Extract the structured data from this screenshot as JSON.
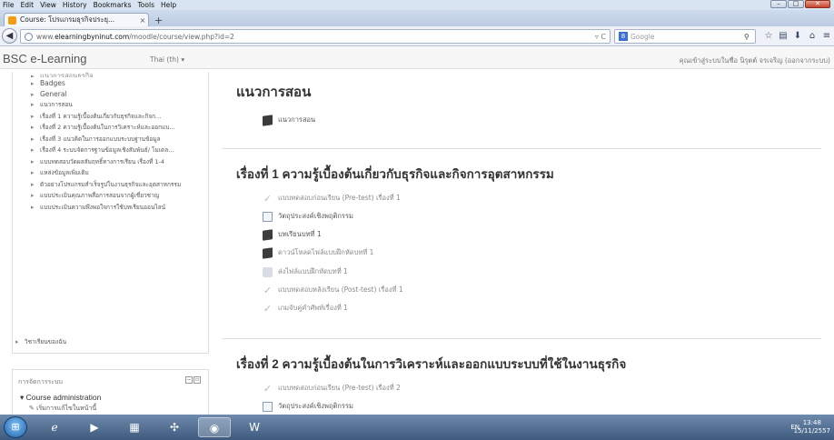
{
  "browser": {
    "menu": [
      "File",
      "Edit",
      "View",
      "History",
      "Bookmarks",
      "Tools",
      "Help"
    ],
    "tab_title": "Course: โปรแกรมธุรกิจประยุ...",
    "url_prefix": "www.",
    "url_domain": "elearningbyninut.com",
    "url_path": "/moodle/course/view.php?id=2",
    "search_placeholder": "Google",
    "search_engine": "8"
  },
  "site": {
    "name": "BSC e-Learning",
    "language": "Thai (th) ▾",
    "user_info": "คุณเข้าสู่ระบบในชื่อ นิรุตต์ จรเจริญ (ออกจากระบบ)"
  },
  "sidebar": {
    "cut_item": "แนวการสอนธุรกิจ",
    "items": [
      "Badges",
      "General",
      "แนวการสอน",
      "เรื่องที่ 1 ความรู้เบื้องต้นเกี่ยวกับธุรกิจและกิจก...",
      "เรื่องที่ 2 ความรู้เบื้องต้นในการวิเคราะห์และออกแบ...",
      "เรื่องที่ 3 แนวคิดในการออกแบบระบบฐานข้อมูล",
      "เรื่องที่ 4 ระบบจัดการฐานข้อมูลเชิงสัมพันธ์/ โมเดล...",
      "แบบทดสอบวัดผลสัมฤทธิ์ทางการเรียน เรื่องที่ 1-4",
      "แหล่งข้อมูลเพิ่มเติม",
      "ตัวอย่างโปรแกรมสำเร็จรูปในงานธุรกิจและอุตสาหกรรม",
      "แบบประเมินคุณภาพสื่อการสอนจากผู้เชี่ยวชาญ",
      "แบบประเมินความพึงพอใจการใช้บทเรียนออนไลน์"
    ],
    "my_courses": "วิชาเรียนของฉัน",
    "admin_block_title": "การจัดการระบบ",
    "course_admin": "Course administration",
    "turn_editing": "เริ่มการแก้ไขในหน้านี้"
  },
  "main": {
    "section0": {
      "title": "แนวการสอน",
      "activities": [
        {
          "label": "แนวการสอน",
          "icon": "book"
        }
      ]
    },
    "section1": {
      "title": "เรื่องที่ 1 ความรู้เบื้องต้นเกี่ยวกับธุรกิจและกิจการอุตสาหกรรม",
      "activities": [
        {
          "label": "แบบทดสอบก่อนเรียน (Pre-test) เรื่องที่ 1",
          "icon": "check"
        },
        {
          "label": "วัตถุประสงค์เชิงพฤติกรรม",
          "icon": "page"
        },
        {
          "label": "บทเรียนบทที่ 1",
          "icon": "book"
        },
        {
          "label": "ดาวน์โหลดไฟล์แบบฝึกหัดบทที่ 1",
          "icon": "book"
        },
        {
          "label": "ส่งไฟล์แบบฝึกหัดบทที่ 1",
          "icon": "assign"
        },
        {
          "label": "แบบทดสอบหลังเรียน (Post-test) เรื่องที่ 1",
          "icon": "check"
        },
        {
          "label": "เกมจับคู่คำศัพท์เรื่องที่ 1",
          "icon": "check"
        }
      ]
    },
    "section2": {
      "title": "เรื่องที่ 2 ความรู้เบื้องต้นในการวิเคราะห์และออกแบบระบบที่ใช้ในงานธุรกิจ",
      "activities": [
        {
          "label": "แบบทดสอบก่อนเรียน (Pre-test) เรื่องที่ 2",
          "icon": "check"
        },
        {
          "label": "วัตถุประสงค์เชิงพฤติกรรม",
          "icon": "page"
        }
      ]
    }
  },
  "taskbar": {
    "tray": "EN",
    "time": "13:48",
    "date": "15/11/2557"
  }
}
